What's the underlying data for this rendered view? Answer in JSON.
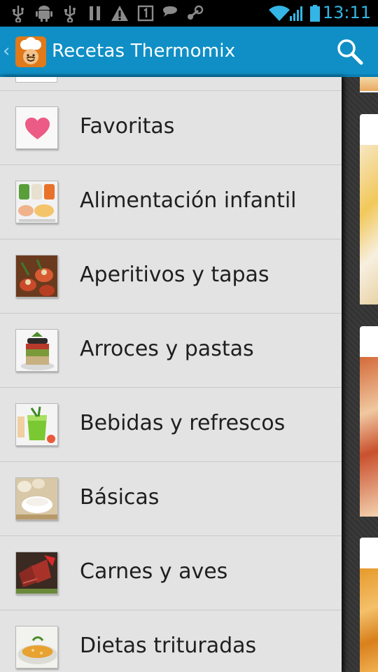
{
  "status_bar": {
    "time": "13:11",
    "icons": [
      "usb-icon",
      "android-debug-icon",
      "usb-icon",
      "pause-icon",
      "warning-icon",
      "sim-one-icon",
      "voicemail-icon",
      "steam-icon",
      "wifi-icon",
      "signal-icon",
      "battery-icon"
    ],
    "accent": "#33b5e5"
  },
  "action_bar": {
    "title": "Recetas Thermomix",
    "background": "#0f8fc6",
    "search_icon": "search-icon"
  },
  "drawer": {
    "items": [
      {
        "label": "Favoritas",
        "icon": "heart-icon"
      },
      {
        "label": "Alimentación infantil",
        "icon": "baby-food-icon"
      },
      {
        "label": "Aperitivos y tapas",
        "icon": "appetizer-icon"
      },
      {
        "label": "Arroces y pastas",
        "icon": "rice-pasta-icon"
      },
      {
        "label": "Bebidas y refrescos",
        "icon": "drink-icon"
      },
      {
        "label": "Básicas",
        "icon": "basics-icon"
      },
      {
        "label": "Carnes y aves",
        "icon": "meat-icon"
      },
      {
        "label": "Dietas trituradas",
        "icon": "puree-icon"
      }
    ]
  }
}
